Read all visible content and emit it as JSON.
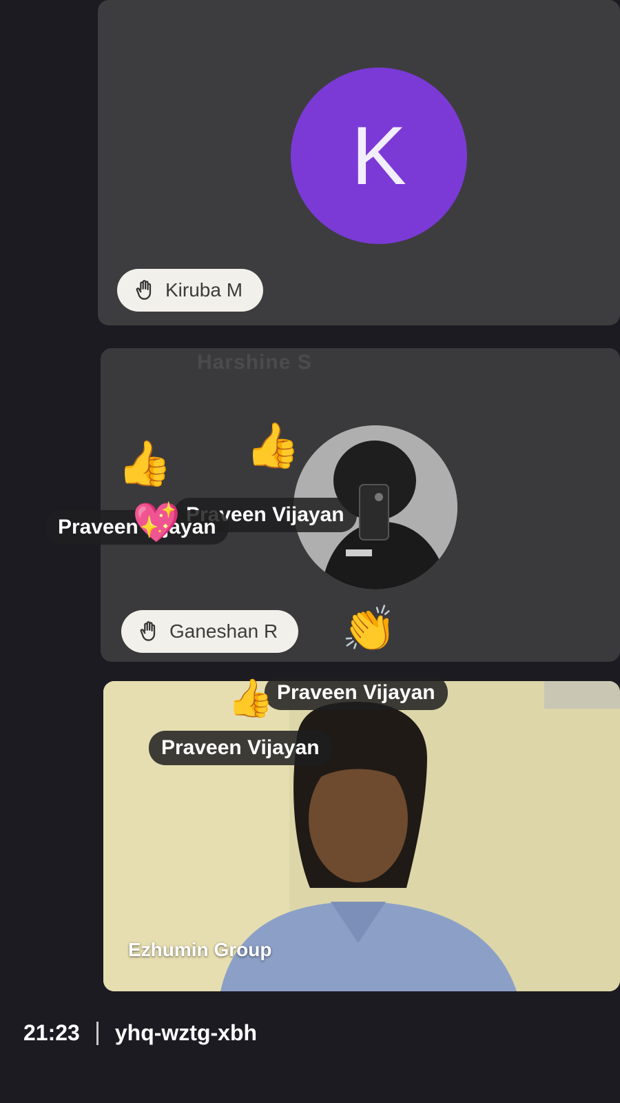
{
  "participants": [
    {
      "name": "Kiruba M",
      "avatar_letter": "K",
      "avatar_color": "#7b3ad6",
      "status_icon": "raised-hand-icon"
    },
    {
      "name": "Ganeshan R",
      "ghost_name": "Harshine S",
      "status_icon": "raised-hand-icon"
    },
    {
      "caption": "Ezhumin Group"
    }
  ],
  "reactions": [
    {
      "name": "Praveen Vijayan",
      "emoji": "👍"
    },
    {
      "name": "Praveen Vijayan",
      "emoji": "👍"
    },
    {
      "name": "Praveen Vijayan",
      "emoji": "💖"
    },
    {
      "name": "Praveen Vijayan",
      "emoji": "👏"
    },
    {
      "name": "Praveen Vijayan",
      "emoji": "👍"
    }
  ],
  "footer": {
    "time": "21:23",
    "meeting_code": "yhq-wztg-xbh"
  }
}
